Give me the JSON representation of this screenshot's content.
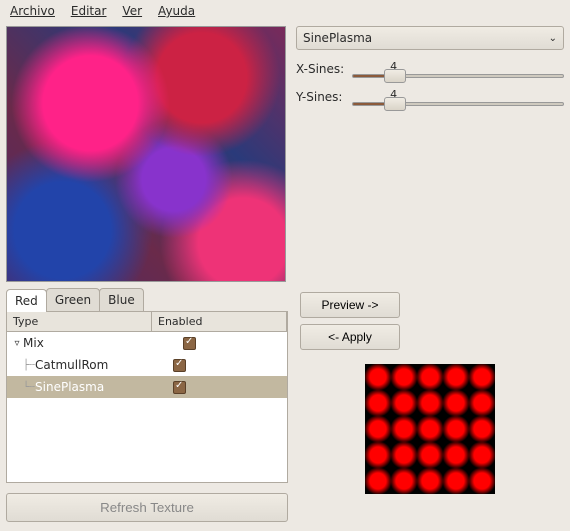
{
  "menu": {
    "file": "Archivo",
    "edit": "Editar",
    "view": "Ver",
    "help": "Ayuda"
  },
  "tabs": {
    "red": "Red",
    "green": "Green",
    "blue": "Blue",
    "active": "Red"
  },
  "columns": {
    "type": "Type",
    "enabled": "Enabled"
  },
  "tree": {
    "items": [
      {
        "label": "Mix",
        "indent": 0,
        "checked": true,
        "expanded": true
      },
      {
        "label": "CatmullRom",
        "indent": 1,
        "checked": true
      },
      {
        "label": "SinePlasma",
        "indent": 1,
        "checked": true,
        "selected": true
      }
    ]
  },
  "refresh_label": "Refresh Texture",
  "filter": {
    "selected": "SinePlasma"
  },
  "sliders": {
    "x": {
      "label": "X-Sines:",
      "value": "4"
    },
    "y": {
      "label": "Y-Sines:",
      "value": "4"
    }
  },
  "buttons": {
    "preview": "Preview ->",
    "apply": "<- Apply"
  }
}
